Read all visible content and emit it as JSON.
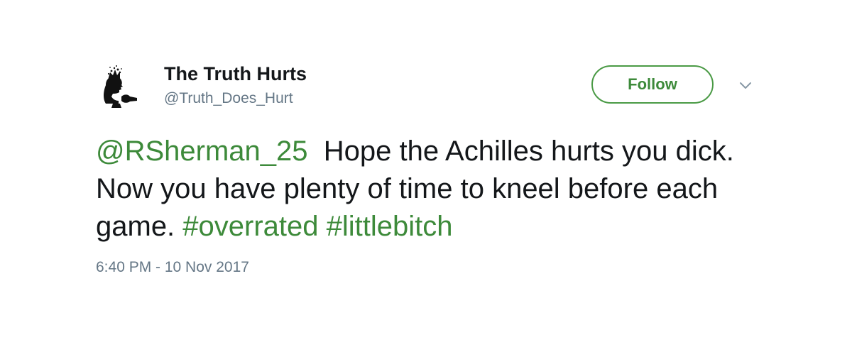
{
  "author": {
    "display_name": "The Truth Hurts",
    "handle": "@Truth_Does_Hurt",
    "avatar_icon": "silhouette-avatar-icon"
  },
  "actions": {
    "follow_label": "Follow",
    "menu_icon": "chevron-down-icon"
  },
  "tweet": {
    "mention": "@RSherman_25",
    "text_part1": "  Hope the Achilles hurts you dick. Now you have plenty of time to kneel before each game. ",
    "hashtag1": "#overrated",
    "space": " ",
    "hashtag2": "#littlebitch",
    "timestamp": "6:40 PM - 10 Nov 2017"
  },
  "colors": {
    "link": "#3d8a3a",
    "text": "#14171a",
    "muted": "#657786"
  }
}
